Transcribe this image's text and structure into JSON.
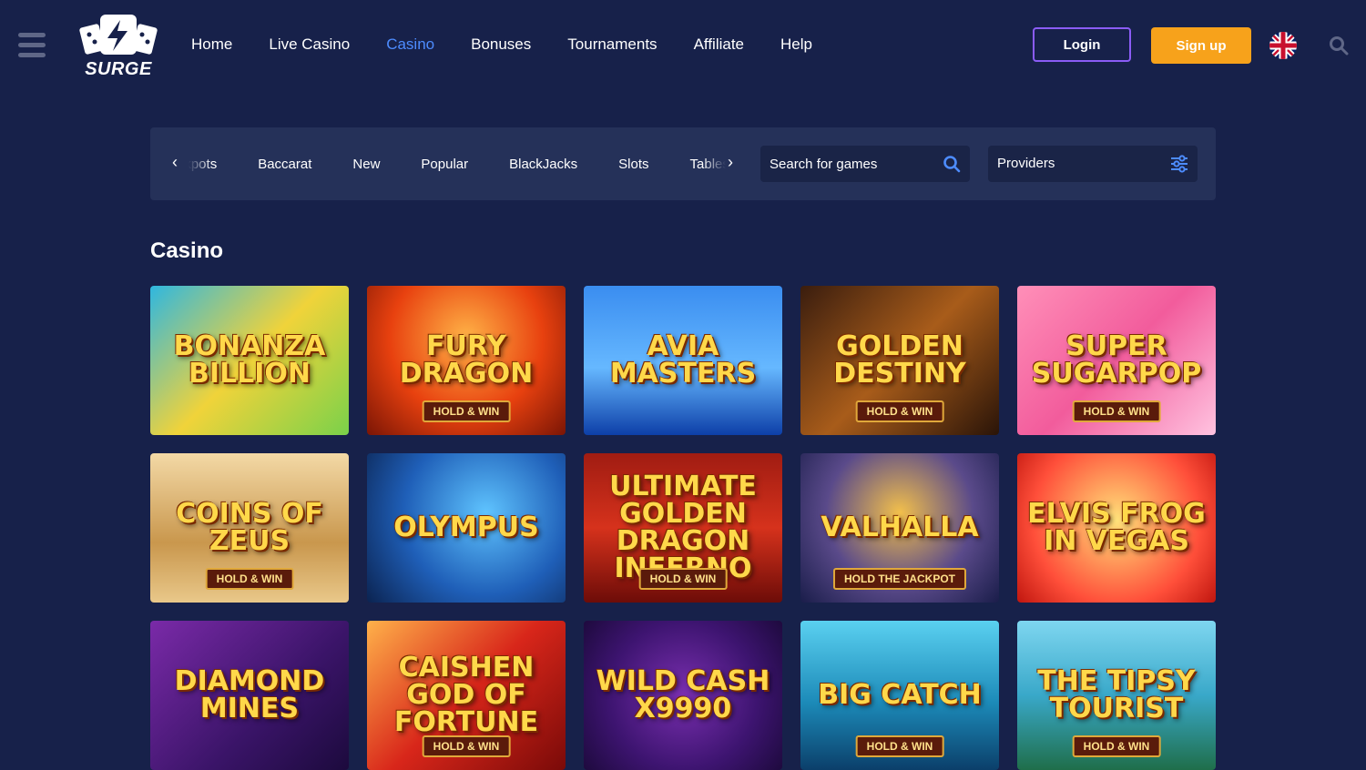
{
  "header": {
    "logo_text": "SURGE",
    "nav": [
      "Home",
      "Live Casino",
      "Casino",
      "Bonuses",
      "Tournaments",
      "Affiliate",
      "Help"
    ],
    "active_nav": "Casino",
    "login_label": "Login",
    "signup_label": "Sign up"
  },
  "filters": {
    "categories": [
      "Jackpots",
      "Baccarat",
      "New",
      "Popular",
      "BlackJacks",
      "Slots",
      "Tables"
    ],
    "search_placeholder": "Search for games",
    "providers_label": "Providers"
  },
  "section": {
    "title": "Casino",
    "games": [
      {
        "name": "BONANZA BILLION",
        "tag": "",
        "bg": "linear-gradient(135deg,#2fb7e0,#f0d33a,#7ad14a)"
      },
      {
        "name": "FURY DRAGON",
        "tag": "HOLD & WIN",
        "bg": "radial-gradient(circle at 50% 35%,#ffb347,#e8410f 55%,#7a1505)"
      },
      {
        "name": "AVIA MASTERS",
        "tag": "",
        "bg": "linear-gradient(180deg,#3a8df0,#66b8ff 55%,#0d3fa8)"
      },
      {
        "name": "GOLDEN DESTINY",
        "tag": "HOLD & WIN",
        "bg": "linear-gradient(135deg,#3a1d0e,#a85c1a 50%,#2a1408)"
      },
      {
        "name": "SUPER SUGARPOP",
        "tag": "HOLD & WIN",
        "bg": "linear-gradient(135deg,#ff8fb8,#f25c9c 50%,#ffc3e0)"
      },
      {
        "name": "COINS OF ZEUS",
        "tag": "HOLD & WIN",
        "bg": "linear-gradient(180deg,#f3d9a6,#c9974d 60%,#e9c88a)"
      },
      {
        "name": "OLYMPUS",
        "tag": "",
        "bg": "radial-gradient(circle at 60% 40%,#5fc4ff,#1f5fb8 55%,#0b2350)"
      },
      {
        "name": "ULTIMATE GOLDEN DRAGON INFERNO",
        "tag": "HOLD & WIN",
        "bg": "linear-gradient(180deg,#a01c12,#d6321c 50%,#6d0c08)"
      },
      {
        "name": "VALHALLA",
        "tag": "HOLD THE JACKPOT",
        "bg": "radial-gradient(circle at 50% 40%,#f3c04b,#5a4a8a 55%,#1a1d4a)"
      },
      {
        "name": "ELVIS FROG IN VEGAS",
        "tag": "",
        "bg": "radial-gradient(circle at 50% 45%,#ffe27a,#ff4f3a 65%,#c0160f)"
      },
      {
        "name": "DIAMOND MINES",
        "tag": "",
        "bg": "linear-gradient(135deg,#7a2aa8,#3a1468 60%,#1c0a3d)"
      },
      {
        "name": "CAISHEN GOD OF FORTUNE",
        "tag": "HOLD & WIN",
        "bg": "linear-gradient(135deg,#ffb14a,#d8261a 50%,#7a0a08)"
      },
      {
        "name": "WILD CASH X9990",
        "tag": "",
        "bg": "radial-gradient(circle at 50% 50%,#7a2fb0,#3d1470 60%,#1e0a3e)"
      },
      {
        "name": "BIG CATCH",
        "tag": "HOLD & WIN",
        "bg": "linear-gradient(180deg,#5ad0f0,#1c8ab8 55%,#0b3f6a)"
      },
      {
        "name": "THE TIPSY TOURIST",
        "tag": "HOLD & WIN",
        "bg": "linear-gradient(180deg,#7ed6f0,#39a8c9 50%,#1f6e4a)"
      }
    ]
  },
  "colors": {
    "background": "#17214a",
    "filter_bar": "#253159",
    "accent_blue": "#4d8cff",
    "login_border": "#8b5cf6",
    "signup": "#f7a21b"
  },
  "icons": [
    "hamburger-icon",
    "logo-cards-icon",
    "uk-flag-icon",
    "search-icon",
    "filter-sliders-icon",
    "chevron-left-icon",
    "chevron-right-icon"
  ]
}
